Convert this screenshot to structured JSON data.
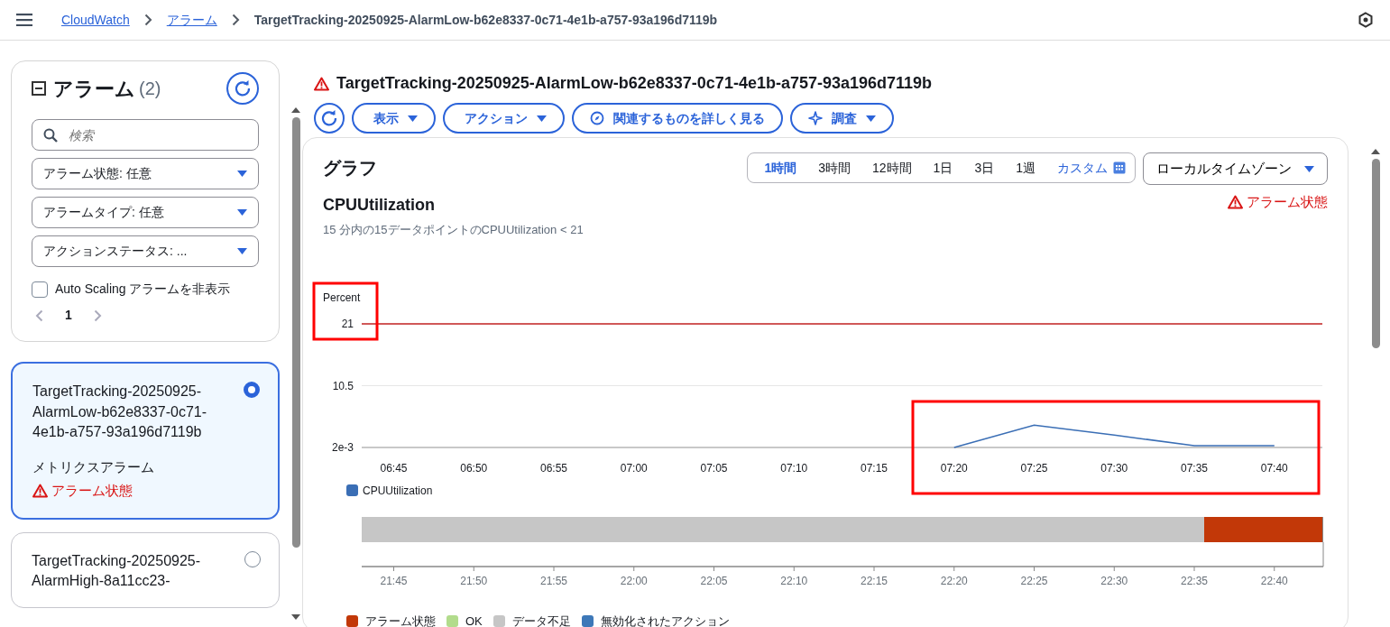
{
  "breadcrumbs": [
    {
      "label": "CloudWatch",
      "link": true
    },
    {
      "label": "アラーム",
      "link": true
    },
    {
      "label": "TargetTracking-20250925-AlarmLow-b62e8337-0c71-4e1b-a757-93a196d7119b",
      "link": false
    }
  ],
  "sidebar": {
    "title": "アラーム",
    "count": "(2)",
    "search": {
      "placeholder": "検索"
    },
    "filters": [
      {
        "label": "アラーム状態: 任意"
      },
      {
        "label": "アラームタイプ: 任意"
      },
      {
        "label": "アクションステータス: ..."
      }
    ],
    "hide_autoscaling": {
      "label": "Auto Scaling アラームを非表示",
      "checked": false
    },
    "page": "1",
    "alarms": [
      {
        "name": "TargetTracking-20250925-AlarmLow-b62e8337-0c71-4e1b-a757-93a196d7119b",
        "type": "メトリクスアラーム",
        "state": "アラーム状態",
        "selected": true
      },
      {
        "name": "TargetTracking-20250925-AlarmHigh-8a11cc23-",
        "selected": false
      }
    ]
  },
  "detail": {
    "title": "TargetTracking-20250925-AlarmLow-b62e8337-0c71-4e1b-a757-93a196d7119b",
    "actions": [
      {
        "label": "表示",
        "kind": "dropdown"
      },
      {
        "label": "アクション",
        "kind": "dropdown"
      },
      {
        "label": "関連するものを詳しく見る",
        "kind": "compass"
      },
      {
        "label": "調査",
        "kind": "sparkle"
      }
    ],
    "graph": {
      "heading": "グラフ",
      "ranges": [
        {
          "label": "1時間",
          "selected": true
        },
        {
          "label": "3時間",
          "selected": false
        },
        {
          "label": "12時間",
          "selected": false
        },
        {
          "label": "1日",
          "selected": false
        },
        {
          "label": "3日",
          "selected": false
        },
        {
          "label": "1週",
          "selected": false
        }
      ],
      "custom": "カスタム",
      "timezone": "ローカルタイムゾーン",
      "state": "アラーム状態",
      "metric": "CPUUtilization",
      "condition": "15 分内の15データポイントのCPUUtilization < 21",
      "chart_data": {
        "type": "line",
        "ylabel": "Percent",
        "categories": [
          "06:45",
          "06:50",
          "06:55",
          "07:00",
          "07:05",
          "07:10",
          "07:15",
          "07:20",
          "07:25",
          "07:30",
          "07:35",
          "07:40"
        ],
        "ylim": [
          0,
          21
        ],
        "yticks": [
          {
            "value": 0.002,
            "label": "2e-3"
          },
          {
            "value": 10.5,
            "label": "10.5"
          },
          {
            "value": 21,
            "label": "21"
          }
        ],
        "series": [
          {
            "name": "CPUUtilization",
            "color": "#3a6eb5",
            "values": [
              null,
              null,
              null,
              null,
              null,
              null,
              null,
              0.0,
              3.8,
              2.1,
              0.3,
              0.3
            ]
          }
        ],
        "ref_lines": [
          {
            "axis": "y",
            "value": 21,
            "color": "#c02020"
          }
        ]
      },
      "highlights": [
        {
          "kind": "box"
        },
        {
          "kind": "box"
        }
      ],
      "timeline": {
        "ticks": [
          "21:45",
          "21:50",
          "21:55",
          "22:00",
          "22:05",
          "22:10",
          "22:15",
          "22:20",
          "22:25",
          "22:30",
          "22:35",
          "22:40"
        ],
        "segments": [
          {
            "color": "#c6c6c6",
            "level": 0.877
          },
          {
            "color": "#c23808",
            "level": 0.123
          }
        ],
        "legend": [
          {
            "label": "アラーム状態",
            "color": "#c23808"
          },
          {
            "label": "OK",
            "color": "#b2dc8c"
          },
          {
            "label": "データ不足",
            "color": "#c6c6c6"
          },
          {
            "label": "無効化されたアクション",
            "color": "#3d78b8"
          }
        ]
      }
    }
  }
}
